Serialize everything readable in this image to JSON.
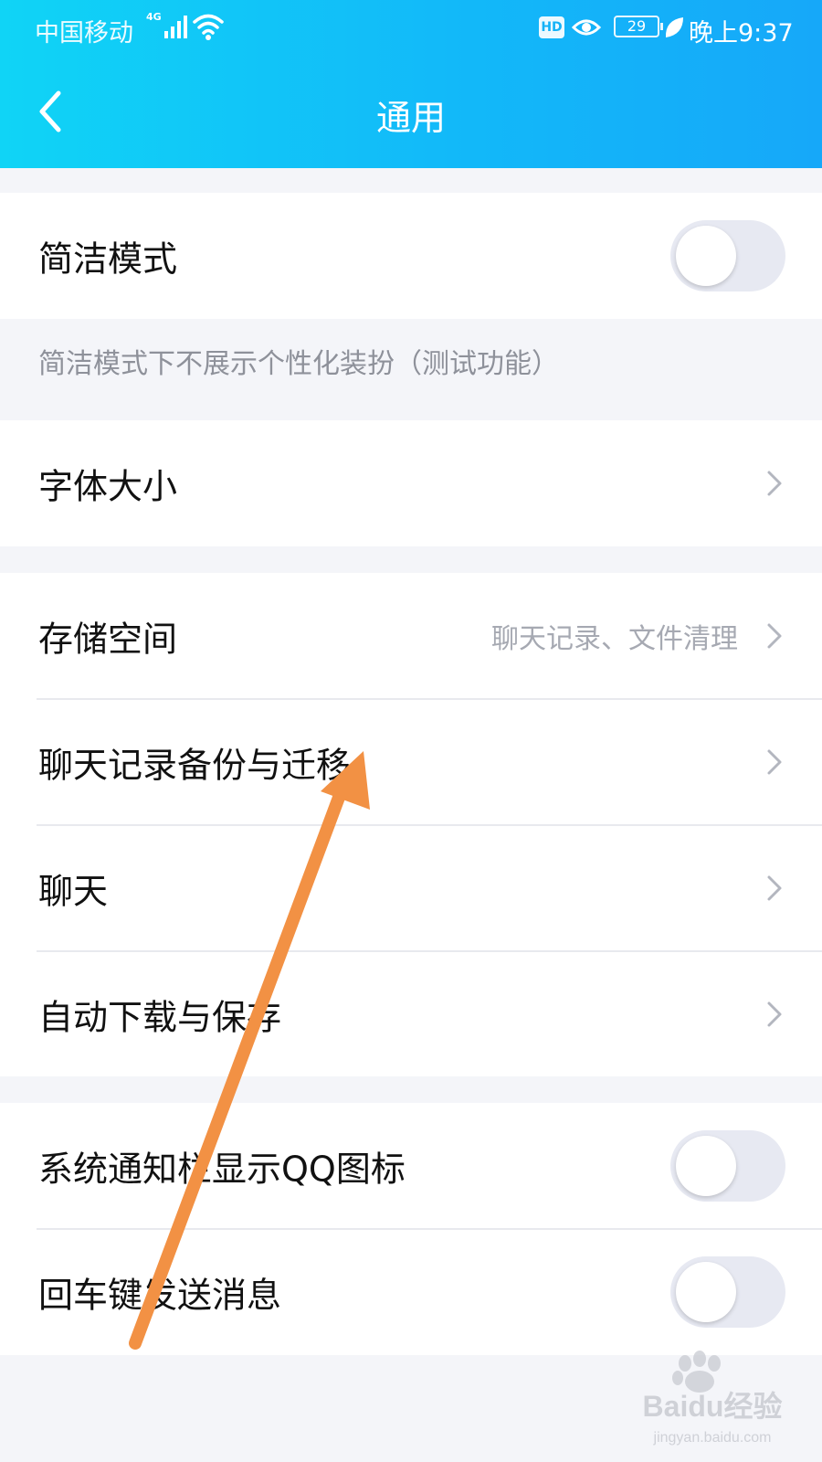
{
  "status_bar": {
    "carrier": "中国移动",
    "network_badge": "4G",
    "hd_label": "HD",
    "battery": "29",
    "time": "晚上9:37",
    "icons": [
      "signal-icon",
      "wifi-icon",
      "eye-icon",
      "leaf-icon"
    ]
  },
  "header": {
    "title": "通用",
    "back_icon": "back-chevron-icon"
  },
  "sections": {
    "simple_mode": {
      "label": "简洁模式",
      "toggle_on": false,
      "note": "简洁模式下不展示个性化装扮（测试功能）"
    },
    "font_size": {
      "label": "字体大小"
    },
    "storage": {
      "label": "存储空间",
      "hint": "聊天记录、文件清理"
    },
    "backup": {
      "label": "聊天记录备份与迁移"
    },
    "chat": {
      "label": "聊天"
    },
    "auto_download": {
      "label": "自动下载与保存"
    },
    "notify_icon": {
      "label": "系统通知栏显示QQ图标",
      "toggle_on": false
    },
    "enter_send": {
      "label": "回车键发送消息",
      "toggle_on": false
    }
  },
  "annotation": {
    "arrow_color": "#f29144"
  },
  "watermark": {
    "text": "Baidu经验",
    "url": "jingyan.baidu.com"
  },
  "colors": {
    "header_gradient_start": "#10d4f6",
    "header_gradient_end": "#16a8f9",
    "page_background": "#f4f5f9",
    "toggle_off": "#e7e9f2"
  }
}
